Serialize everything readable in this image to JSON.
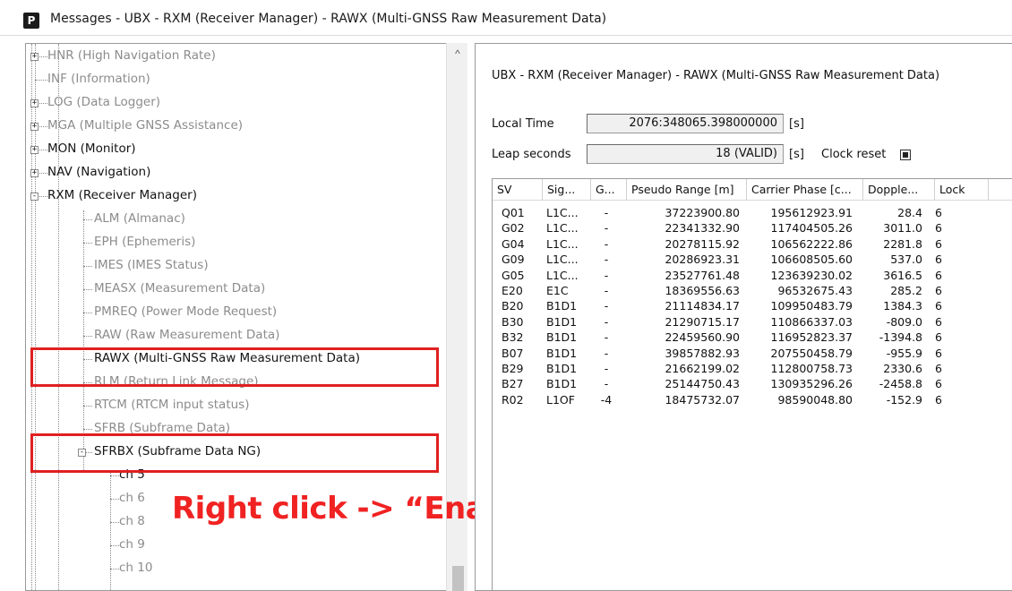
{
  "window": {
    "icon_letter": "P",
    "title": "Messages - UBX - RXM (Receiver Manager) - RAWX (Multi-GNSS Raw Measurement Data)"
  },
  "tree": {
    "items": [
      {
        "label": "HNR (High Navigation Rate)",
        "style": "dim",
        "expander": "+"
      },
      {
        "label": "INF (Information)",
        "style": "dim",
        "expander": ""
      },
      {
        "label": "LOG (Data Logger)",
        "style": "dim",
        "expander": "+"
      },
      {
        "label": "MGA (Multiple GNSS Assistance)",
        "style": "dim",
        "expander": "+"
      },
      {
        "label": "MON (Monitor)",
        "style": "dark",
        "expander": "+"
      },
      {
        "label": "NAV (Navigation)",
        "style": "dark",
        "expander": "+"
      },
      {
        "label": "RXM (Receiver Manager)",
        "style": "dark",
        "expander": "-"
      },
      {
        "label": "ALM (Almanac)",
        "style": "dim",
        "expander": ""
      },
      {
        "label": "EPH (Ephemeris)",
        "style": "dim",
        "expander": ""
      },
      {
        "label": "IMES (IMES Status)",
        "style": "dim",
        "expander": ""
      },
      {
        "label": "MEASX (Measurement Data)",
        "style": "dim",
        "expander": ""
      },
      {
        "label": "PMREQ (Power Mode Request)",
        "style": "dim",
        "expander": ""
      },
      {
        "label": "RAW (Raw Measurement Data)",
        "style": "dim",
        "expander": ""
      },
      {
        "label": "RAWX (Multi-GNSS Raw Measurement Data)",
        "style": "dark",
        "expander": ""
      },
      {
        "label": "RLM (Return Link Message)",
        "style": "dim",
        "expander": ""
      },
      {
        "label": "RTCM (RTCM input status)",
        "style": "dim",
        "expander": ""
      },
      {
        "label": "SFRB (Subframe Data)",
        "style": "dim",
        "expander": ""
      },
      {
        "label": "SFRBX (Subframe Data NG)",
        "style": "dark",
        "expander": "-"
      },
      {
        "label": "ch 5",
        "style": "dark",
        "expander": ""
      },
      {
        "label": "ch 6",
        "style": "dim",
        "expander": ""
      },
      {
        "label": "ch 8",
        "style": "dim",
        "expander": ""
      },
      {
        "label": "ch 9",
        "style": "dim",
        "expander": ""
      },
      {
        "label": "ch 10",
        "style": "dim",
        "expander": ""
      }
    ]
  },
  "annotation": "Right click -> “Enable”",
  "detail": {
    "title": "UBX - RXM (Receiver Manager) - RAWX (Multi-GNSS Raw Measurement Data)",
    "local_time_label": "Local Time",
    "local_time_value": "2076:348065.398000000",
    "local_time_unit": "[s]",
    "leap_seconds_label": "Leap seconds",
    "leap_seconds_value": "18 (VALID)",
    "leap_seconds_unit": "[s]",
    "clock_reset_label": "Clock reset",
    "columns": [
      "SV",
      "Sig...",
      "G...",
      "Pseudo Range [m]",
      "Carrier Phase [c...",
      "Dopple...",
      "Lock"
    ],
    "rows": [
      [
        "Q01",
        "L1C...",
        "-",
        "37223900.80",
        "195612923.91",
        "28.4",
        "6"
      ],
      [
        "G02",
        "L1C...",
        "-",
        "22341332.90",
        "117404505.26",
        "3011.0",
        "6"
      ],
      [
        "G04",
        "L1C...",
        "-",
        "20278115.92",
        "106562222.86",
        "2281.8",
        "6"
      ],
      [
        "G09",
        "L1C...",
        "-",
        "20286923.31",
        "106608505.60",
        "537.0",
        "6"
      ],
      [
        "G05",
        "L1C...",
        "-",
        "23527761.48",
        "123639230.02",
        "3616.5",
        "6"
      ],
      [
        "E20",
        "E1C",
        "-",
        "18369556.63",
        "96532675.43",
        "285.2",
        "6"
      ],
      [
        "B20",
        "B1D1",
        "-",
        "21114834.17",
        "109950483.79",
        "1384.3",
        "6"
      ],
      [
        "B30",
        "B1D1",
        "-",
        "21290715.17",
        "110866337.03",
        "-809.0",
        "6"
      ],
      [
        "B32",
        "B1D1",
        "-",
        "22459560.90",
        "116952823.37",
        "-1394.8",
        "6"
      ],
      [
        "B07",
        "B1D1",
        "-",
        "39857882.93",
        "207550458.79",
        "-955.9",
        "6"
      ],
      [
        "B29",
        "B1D1",
        "-",
        "21662199.02",
        "112800758.73",
        "2330.6",
        "6"
      ],
      [
        "B27",
        "B1D1",
        "-",
        "25144750.43",
        "130935296.26",
        "-2458.8",
        "6"
      ],
      [
        "R02",
        "L1OF",
        "-4",
        "18475732.07",
        "98590048.80",
        "-152.9",
        "6"
      ]
    ]
  }
}
